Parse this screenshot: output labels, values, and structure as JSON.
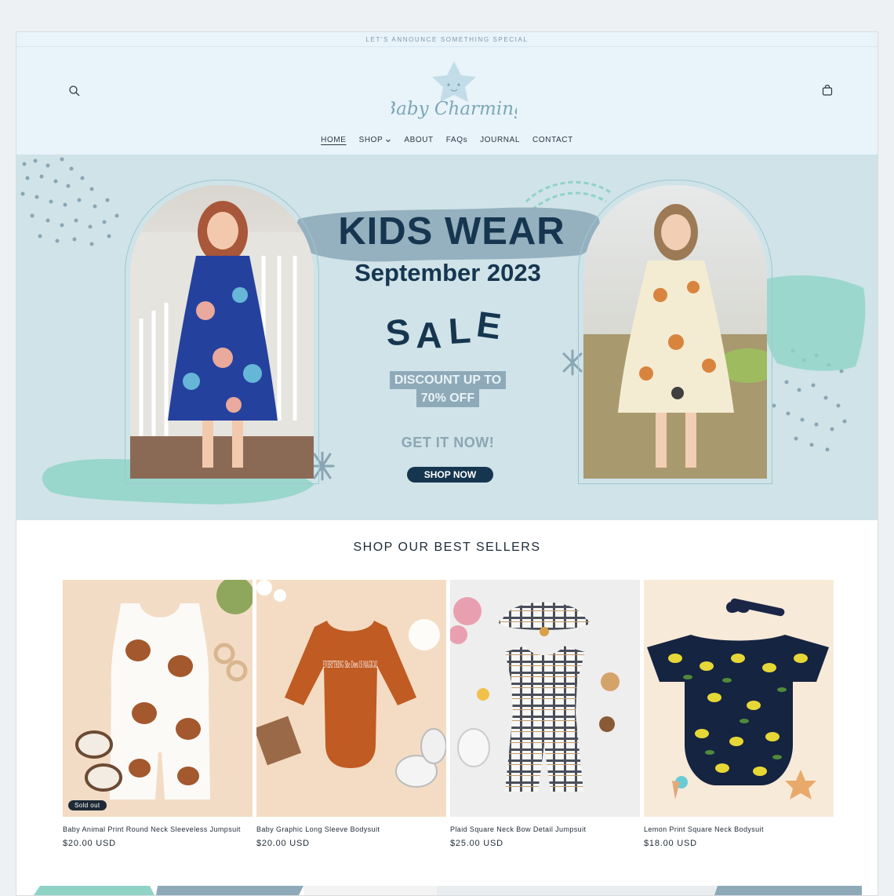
{
  "announcement": "LET'S ANNOUNCE SOMETHING SPECIAL",
  "brand": {
    "name": "Baby Charming",
    "color": "#7fa7b6"
  },
  "nav": {
    "items": [
      {
        "label": "HOME"
      },
      {
        "label": "SHOP"
      },
      {
        "label": "ABOUT"
      },
      {
        "label": "FAQs"
      },
      {
        "label": "JOURNAL"
      },
      {
        "label": "CONTACT"
      }
    ]
  },
  "hero": {
    "title": "KIDS WEAR",
    "date": "September 2023",
    "sale_letters": [
      "S",
      "A",
      "L",
      "E"
    ],
    "discount_line1": "DISCOUNT UP TO",
    "discount_line2": "70% OFF",
    "get_it": "GET IT NOW!",
    "cta": "SHOP NOW"
  },
  "best_sellers": {
    "title": "SHOP OUR BEST SELLERS",
    "products": [
      {
        "name": "Baby Animal Print Round Neck Sleeveless Jumpsuit",
        "price": "$20.00 USD",
        "badge": "Sold out"
      },
      {
        "name": "Baby Graphic Long Sleeve Bodysuit",
        "price": "$20.00 USD",
        "print_text": "EVERYTHING She Does IS MAGICAL"
      },
      {
        "name": "Plaid Square Neck Bow Detail Jumpsuit",
        "price": "$25.00 USD"
      },
      {
        "name": "Lemon Print Square Neck Bodysuit",
        "price": "$18.00 USD"
      }
    ]
  },
  "colors": {
    "header_bg": "#e8f3fa",
    "hero_bg": "#cfe3e8",
    "navy": "#163650",
    "mint": "#8fd3c7"
  },
  "icons": [
    "search-icon",
    "cart-icon",
    "chevron-down-icon",
    "star-icon"
  ]
}
